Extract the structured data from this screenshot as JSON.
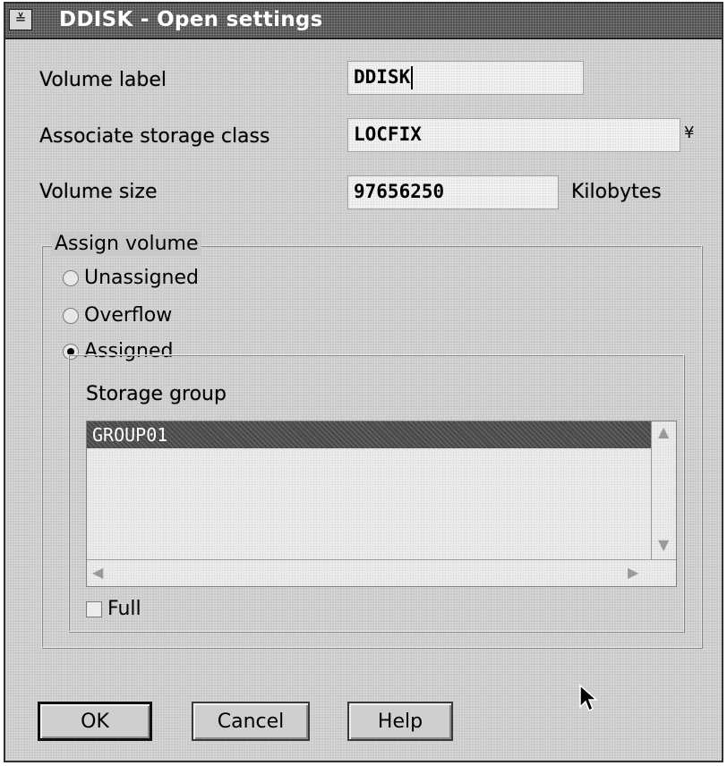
{
  "window": {
    "title": "DDISK - Open settings",
    "system_menu_glyph": "≚"
  },
  "form": {
    "volume_label": {
      "label": "Volume label",
      "value": "DDISK"
    },
    "storage_class": {
      "label": "Associate storage class",
      "value": "LOCFIX",
      "dropdown_glyph": "¥"
    },
    "volume_size": {
      "label": "Volume size",
      "value": "97656250",
      "unit": "Kilobytes"
    }
  },
  "assign_volume": {
    "legend": "Assign volume",
    "options": [
      {
        "label": "Unassigned",
        "selected": false
      },
      {
        "label": "Overflow",
        "selected": false
      },
      {
        "label": "Assigned",
        "selected": true
      }
    ]
  },
  "storage_group": {
    "label": "Storage group",
    "items": [
      "GROUP01"
    ],
    "selected_index": 0,
    "full_label": "Full",
    "full_checked": false
  },
  "buttons": {
    "ok": "OK",
    "cancel": "Cancel",
    "help": "Help"
  },
  "icons": {
    "scroll_up": "up-arrow-icon",
    "scroll_down": "down-arrow-icon",
    "scroll_left": "left-arrow-icon",
    "scroll_right": "right-arrow-icon",
    "pointer": "mouse-pointer-icon"
  }
}
